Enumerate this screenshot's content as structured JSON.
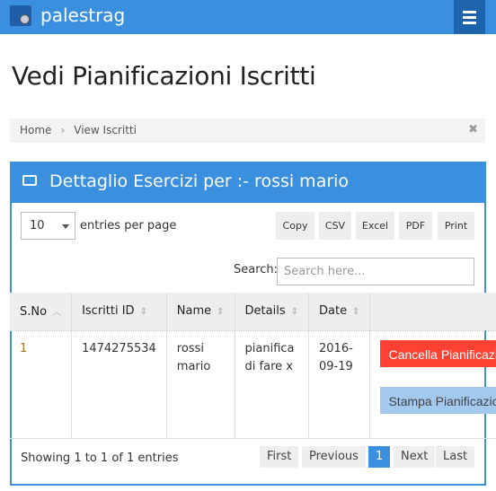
{
  "navbar": {
    "brand": "palestrag",
    "logo_icon": "app-logo",
    "menu_icon": "hamburger-icon"
  },
  "page_title": "Vedi Pianificazioni Iscritti",
  "breadcrumb": {
    "items": [
      "Home",
      "View Iscritti"
    ],
    "separator": "›",
    "close": "✖"
  },
  "panel": {
    "title": "Dettaglio Esercizi per :- rossi mario",
    "icon": "inbox-icon"
  },
  "controls": {
    "entries_value": "10",
    "entries_label": "entries per page",
    "buttons": [
      "Copy",
      "CSV",
      "Excel",
      "PDF",
      "Print"
    ],
    "search_label": "Search:",
    "search_placeholder": "Search here..."
  },
  "table": {
    "headers": [
      "S.No",
      "Iscritti ID",
      "Name",
      "Details",
      "Date",
      ""
    ],
    "rows": [
      {
        "sno": "1",
        "id": "1474275534",
        "name": "rossi mario",
        "details": "pianifica di fare x",
        "date": "2016-09-19",
        "actions": [
          "Cancella Pianificazione",
          "Stampa Pianificazione"
        ]
      }
    ]
  },
  "footer": {
    "showing_prefix": "Showing ",
    "from": "1",
    "to_word": " to ",
    "to": "1",
    "of_word": " of ",
    "total": "1",
    "suffix": " entries",
    "pagination": [
      "First",
      "Previous",
      "1",
      "Next",
      "Last"
    ]
  },
  "colors": {
    "primary": "#3a8fdf",
    "danger": "#fe4132",
    "light_blue": "#a3c9ef"
  }
}
